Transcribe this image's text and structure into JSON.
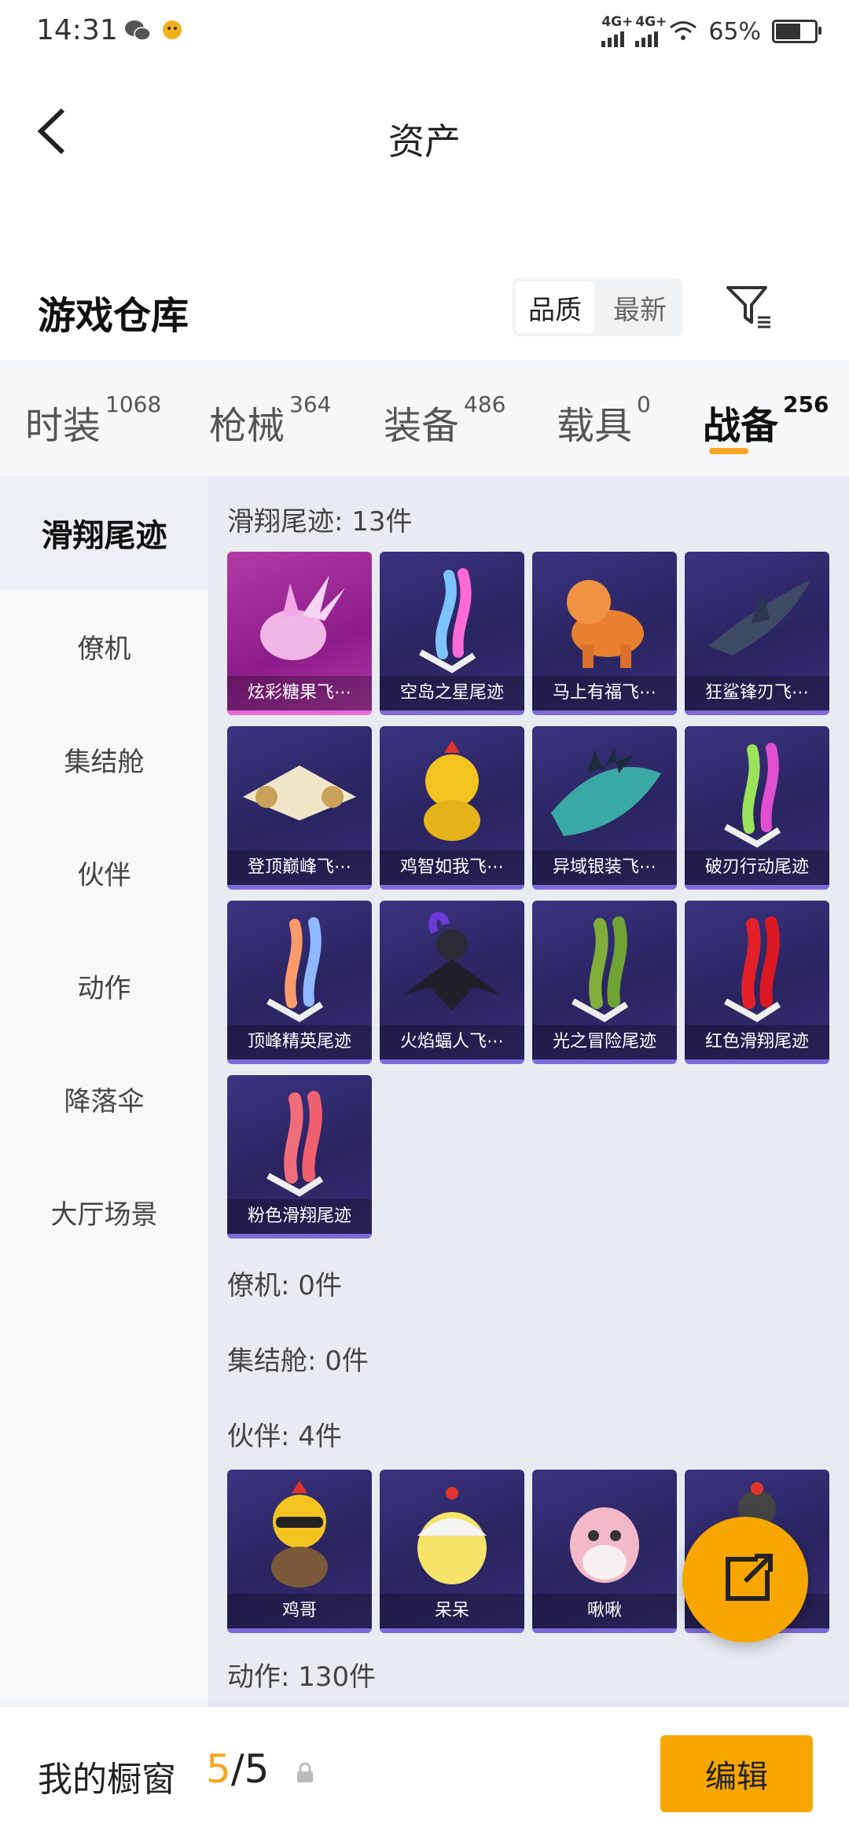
{
  "status_bar": {
    "time": "14:31",
    "signal1": "4G+",
    "signal2": "4G+",
    "battery": "65%"
  },
  "header": {
    "title": "资产"
  },
  "warehouse": {
    "title": "游戏仓库",
    "sort_options": [
      "品质",
      "最新"
    ],
    "active_sort": "品质"
  },
  "tabs": [
    {
      "label": "时装",
      "count": "1068"
    },
    {
      "label": "枪械",
      "count": "364"
    },
    {
      "label": "装备",
      "count": "486"
    },
    {
      "label": "载具",
      "count": "0"
    },
    {
      "label": "战备",
      "count": "256"
    }
  ],
  "sidebar": [
    "滑翔尾迹",
    "僚机",
    "集结舱",
    "伙伴",
    "动作",
    "降落伞",
    "大厅场景"
  ],
  "sections": {
    "glide_trail": "滑翔尾迹: 13件",
    "wingman": "僚机: 0件",
    "pod": "集结舱: 0件",
    "partner": "伙伴: 4件",
    "action": "动作: 130件"
  },
  "glide_items": [
    "炫彩糖果飞⋯",
    "空岛之星尾迹",
    "马上有福飞⋯",
    "狂鲨锋刃飞⋯",
    "登顶巅峰飞⋯",
    "鸡智如我飞⋯",
    "异域银装飞⋯",
    "破刃行动尾迹",
    "顶峰精英尾迹",
    "火焰蝠人飞⋯",
    "光之冒险尾迹",
    "红色滑翔尾迹",
    "粉色滑翔尾迹"
  ],
  "partner_items": [
    "鸡哥",
    "呆呆",
    "啾啾",
    ""
  ],
  "bottom": {
    "title": "我的橱窗",
    "current": "5",
    "total": "/5",
    "edit": "编辑"
  },
  "colors": {
    "accent": "#f7a600",
    "card_bg": "#2a2460",
    "highlight_card": "#8d1c8a"
  }
}
